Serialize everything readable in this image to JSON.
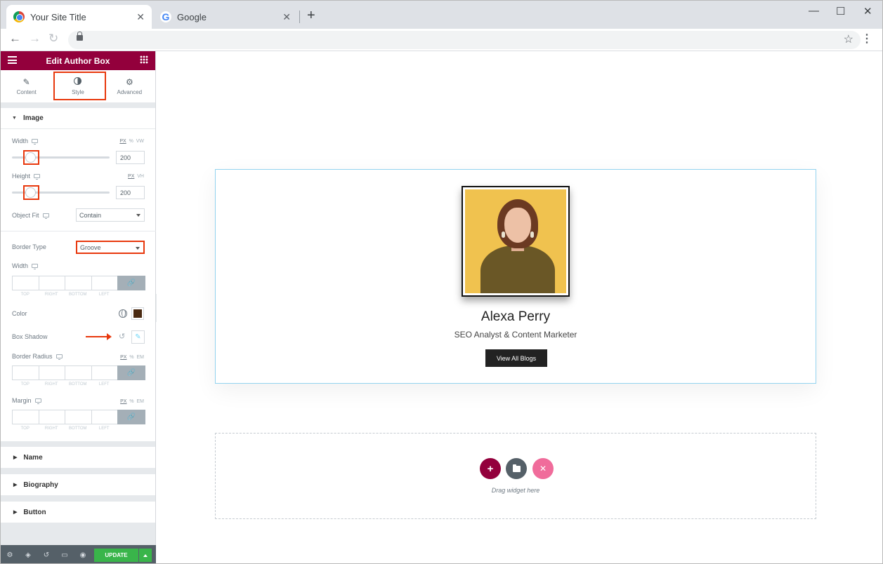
{
  "browser": {
    "tabs": [
      {
        "title": "Your Site Title",
        "close": "✕"
      },
      {
        "title": "Google",
        "close": "✕"
      }
    ],
    "new_tab": "+",
    "window_controls": {
      "minimize": "—",
      "maximize": "☐",
      "close": "✕"
    },
    "nav": {
      "back": "←",
      "forward": "→",
      "reload": "↻"
    },
    "bookmark": "☆",
    "menu": "⋮"
  },
  "panel": {
    "title": "Edit Author Box",
    "tabs": [
      {
        "label": "Content",
        "icon": "pencil-icon",
        "glyph": "✎"
      },
      {
        "label": "Style",
        "icon": "contrast-icon"
      },
      {
        "label": "Advanced",
        "icon": "gear-icon",
        "glyph": "⚙"
      }
    ],
    "active_tab": "Style",
    "image_section": {
      "title": "Image",
      "width": {
        "label": "Width",
        "units": [
          "PX",
          "%",
          "VW"
        ],
        "value": "200"
      },
      "height": {
        "label": "Height",
        "units": [
          "PX",
          "VH"
        ],
        "value": "200"
      },
      "object_fit": {
        "label": "Object Fit",
        "value": "Contain"
      },
      "border_type": {
        "label": "Border Type",
        "value": "Groove"
      },
      "border_width": {
        "label": "Width"
      },
      "dim_labels": [
        "TOP",
        "RIGHT",
        "BOTTOM",
        "LEFT"
      ],
      "color": {
        "label": "Color",
        "value": "#4a2a12"
      },
      "box_shadow": {
        "label": "Box Shadow",
        "reset": "↺",
        "edit": "✎"
      },
      "border_radius": {
        "label": "Border Radius",
        "units": [
          "PX",
          "%",
          "EM"
        ]
      },
      "margin": {
        "label": "Margin",
        "units": [
          "PX",
          "%",
          "EM"
        ]
      },
      "link_glyph": "🔗"
    },
    "collapsed_sections": [
      "Name",
      "Biography",
      "Button"
    ],
    "footer": {
      "icons": [
        "gear-icon",
        "layers-icon",
        "history-icon",
        "responsive-icon",
        "eye-icon"
      ],
      "glyphs": [
        "⚙",
        "◈",
        "↺",
        "▭",
        "◉"
      ],
      "update_label": "UPDATE"
    },
    "collapse_glyph": "‹"
  },
  "canvas": {
    "author": {
      "name": "Alexa Perry",
      "bio": "SEO Analyst & Content Marketer",
      "button_label": "View All Blogs"
    },
    "drop_zone": {
      "text": "Drag widget here",
      "buttons": [
        {
          "icon": "plus-icon",
          "glyph": "+",
          "color": "#93003c"
        },
        {
          "icon": "folder-icon",
          "color": "#556068"
        },
        {
          "icon": "sparkle-icon",
          "glyph": "✕",
          "color": "#f06c9b"
        }
      ]
    }
  },
  "colors": {
    "elementor_brand": "#93003c",
    "update_green": "#39b54a",
    "highlight": "#e8380d"
  }
}
